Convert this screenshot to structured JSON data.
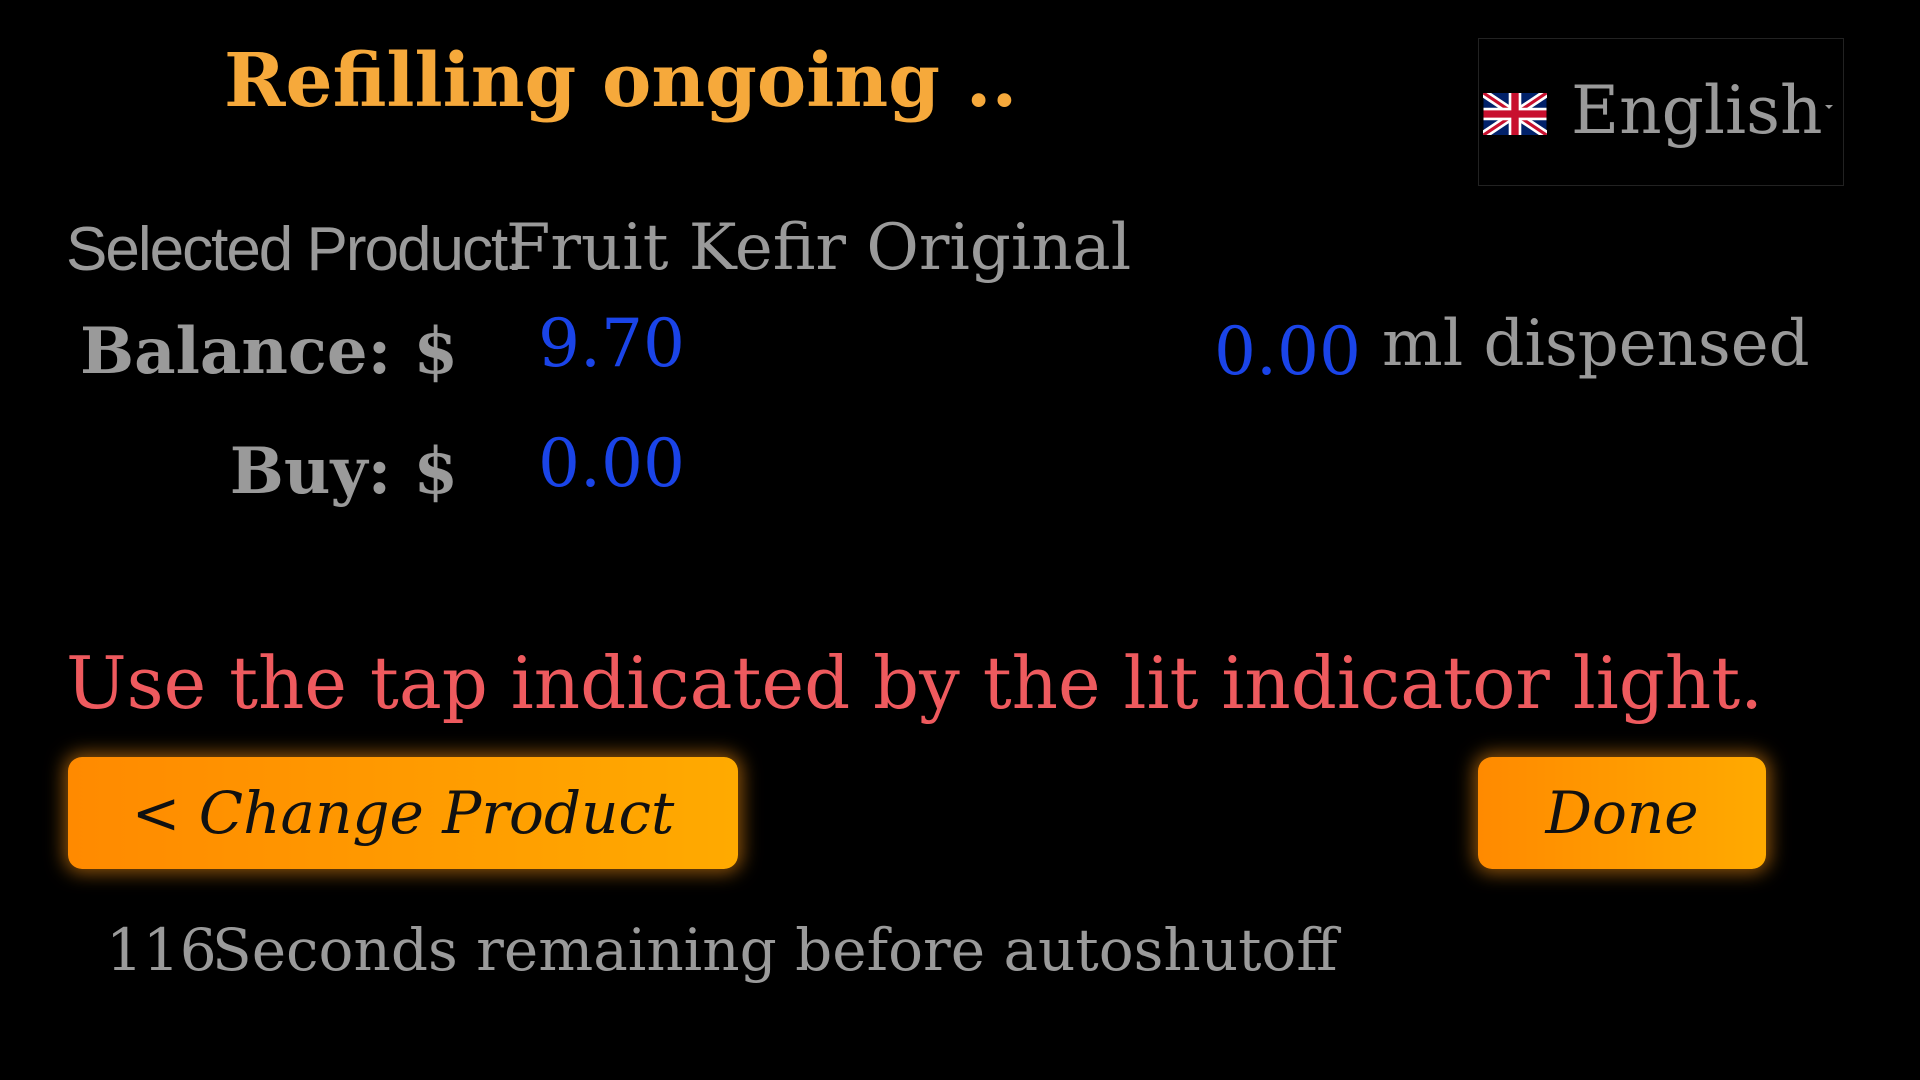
{
  "header": {
    "title": "Refilling ongoing .."
  },
  "language": {
    "selected": "English",
    "flag_icon": "uk-flag-icon"
  },
  "product": {
    "label": "Selected Product:",
    "name": "Fruit Kefir Original"
  },
  "balance": {
    "label": "Balance: $",
    "value": "9.70"
  },
  "buy": {
    "label": "Buy: $",
    "value": "0.00"
  },
  "dispensed": {
    "value": "0.00",
    "label": "ml dispensed"
  },
  "instruction": "Use the tap indicated by the lit indicator light.",
  "buttons": {
    "change_product": "< Change Product",
    "done": "Done"
  },
  "autoshutoff": {
    "seconds": "116",
    "label": "Seconds remaining before autoshutoff"
  },
  "colors": {
    "title": "#f6a93b",
    "amount": "#1a44e8",
    "instruction": "#ee5a5e",
    "button": "#ff9800"
  }
}
